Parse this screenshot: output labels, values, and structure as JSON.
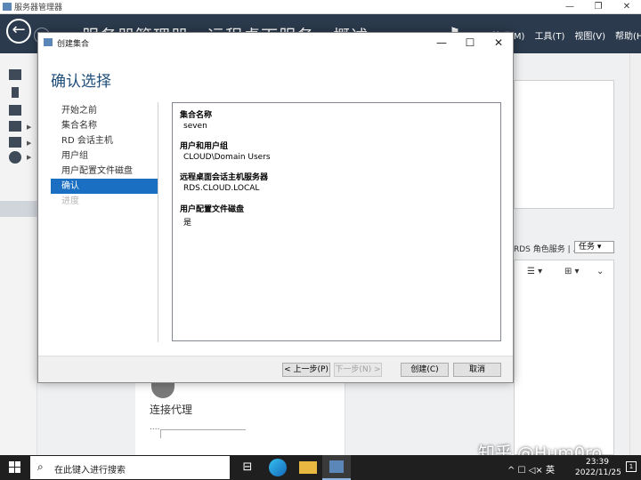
{
  "server_manager": {
    "window_title": "服务器管理器",
    "breadcrumb": "服务器管理器 · 远程桌面服务 · 概述",
    "menu": [
      "管理(M)",
      "工具(T)",
      "视图(V)",
      "帮助(H)"
    ],
    "rds_label": "RDS 角色服务 | ...",
    "task_button": "任务",
    "broker_label": "连接代理",
    "broker_dots": "....",
    "icons": [
      "back-arrow-icon",
      "forward-arrow-icon",
      "flag-icon",
      "dashboard-icon",
      "local-server-icon",
      "all-servers-icon",
      "file-storage-icon",
      "iis-icon",
      "rds-icon"
    ]
  },
  "dialog": {
    "title": "创建集合",
    "heading": "确认选择",
    "steps": [
      {
        "label": "开始之前",
        "state": "normal"
      },
      {
        "label": "集合名称",
        "state": "normal"
      },
      {
        "label": "RD 会话主机",
        "state": "normal"
      },
      {
        "label": "用户组",
        "state": "normal"
      },
      {
        "label": "用户配置文件磁盘",
        "state": "normal"
      },
      {
        "label": "确认",
        "state": "active"
      },
      {
        "label": "进度",
        "state": "disabled"
      }
    ],
    "summary": [
      {
        "label": "集合名称",
        "value": "seven"
      },
      {
        "label": "用户和用户组",
        "value": "CLOUD\\Domain Users"
      },
      {
        "label": "远程桌面会话主机服务器",
        "value": "RDS.CLOUD.LOCAL"
      },
      {
        "label": "用户配置文件磁盘",
        "value": "是"
      }
    ],
    "buttons": {
      "previous": "< 上一步(P)",
      "next": "下一步(N) >",
      "create": "创建(C)",
      "cancel": "取消"
    },
    "accent_color": "#1a6fc2",
    "heading_color": "#1e4e79"
  },
  "watermark": "知乎 @Hum0ro",
  "taskbar": {
    "search_placeholder": "在此键入进行搜索",
    "tray": "^  ☐  ◁×  英",
    "time": "23:39",
    "date": "2022/11/25",
    "notification_count": "1"
  }
}
